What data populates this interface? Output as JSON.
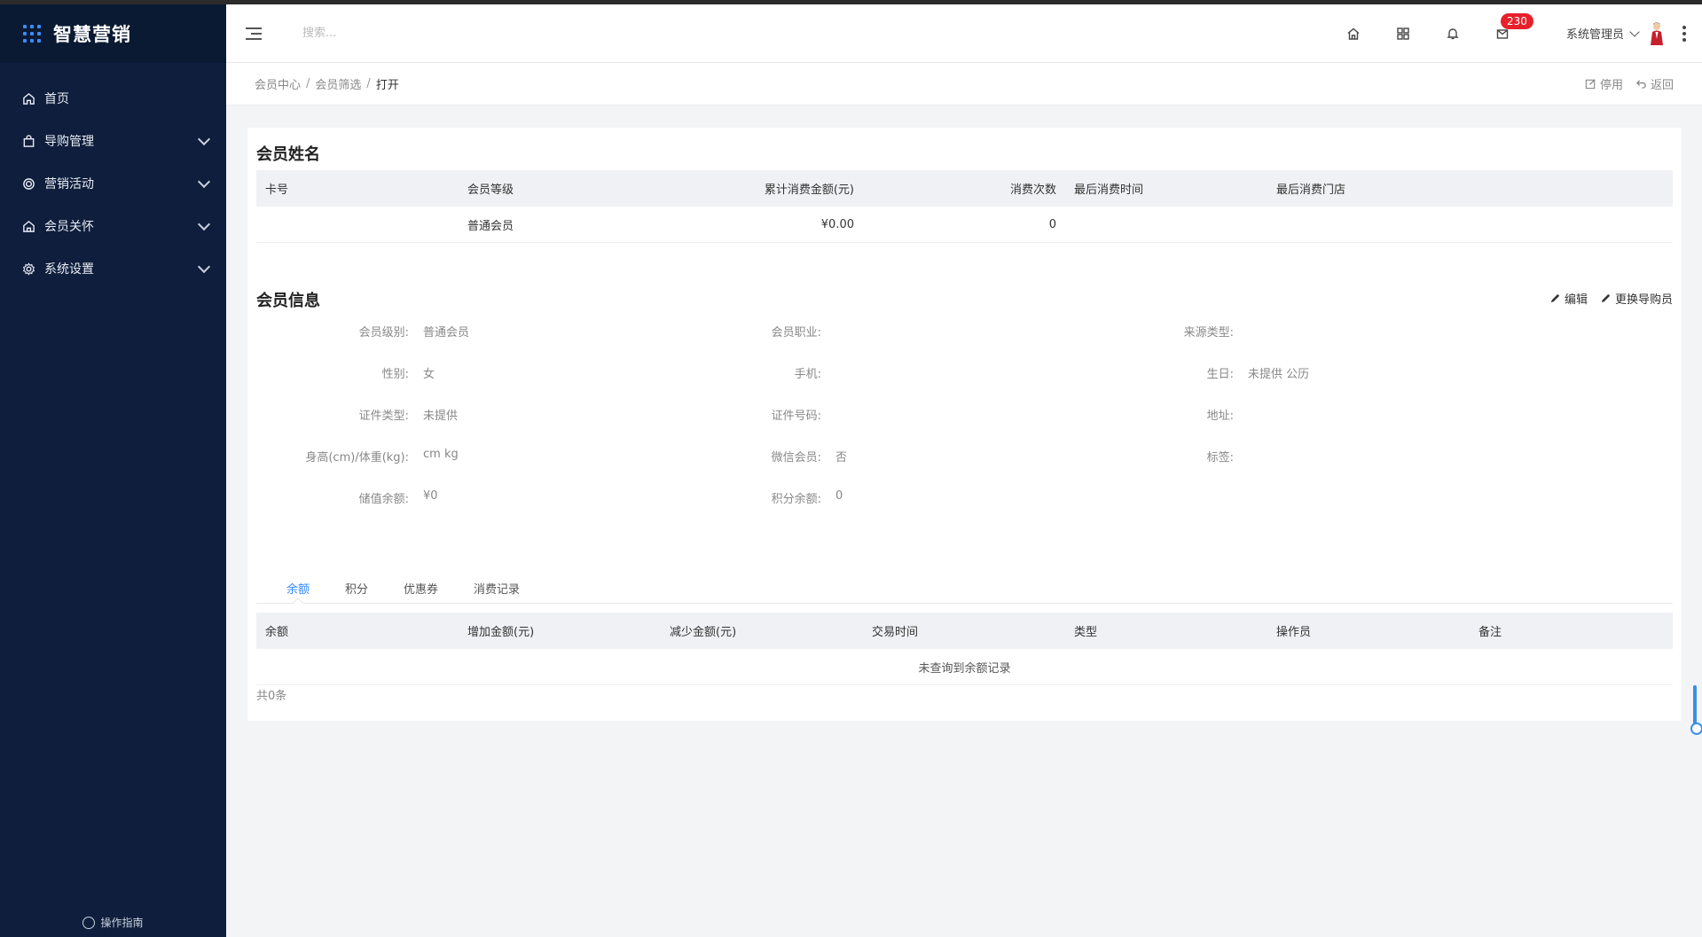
{
  "app": {
    "title": "智慧营销"
  },
  "sidebar": {
    "items": [
      {
        "label": "首页",
        "icon": "home-icon",
        "expandable": false
      },
      {
        "label": "导购管理",
        "icon": "bag-icon",
        "expandable": true
      },
      {
        "label": "营销活动",
        "icon": "target-icon",
        "expandable": true
      },
      {
        "label": "会员关怀",
        "icon": "house-icon",
        "expandable": true
      },
      {
        "label": "系统设置",
        "icon": "gear-icon",
        "expandable": true
      }
    ],
    "guide_label": "操作指南"
  },
  "header": {
    "search_placeholder": "搜索...",
    "message_count": "230",
    "user_name": "系统管理员"
  },
  "breadcrumb": {
    "items": [
      "会员中心",
      "会员筛选",
      "打开"
    ],
    "actions": {
      "disable": "停用",
      "back": "返回"
    }
  },
  "member": {
    "name_title": "会员姓名",
    "summary_headers": [
      "卡号",
      "会员等级",
      "累计消费金额(元)",
      "消费次数",
      "最后消费时间",
      "最后消费门店"
    ],
    "summary_row": [
      "",
      "普通会员",
      "¥0.00",
      "0",
      "",
      ""
    ]
  },
  "info": {
    "title": "会员信息",
    "actions": {
      "edit": "编辑",
      "change_guide": "更换导购员"
    },
    "rows": [
      [
        {
          "label": "会员级别:",
          "value": "普通会员"
        },
        {
          "label": "会员职业:",
          "value": ""
        },
        {
          "label": "来源类型:",
          "value": ""
        }
      ],
      [
        {
          "label": "性别:",
          "value": "女"
        },
        {
          "label": "手机:",
          "value": ""
        },
        {
          "label": "生日:",
          "value": "未提供 公历"
        }
      ],
      [
        {
          "label": "证件类型:",
          "value": "未提供"
        },
        {
          "label": "证件号码:",
          "value": ""
        },
        {
          "label": "地址:",
          "value": ""
        }
      ],
      [
        {
          "label": "身高(cm)/体重(kg):",
          "value": "cm kg"
        },
        {
          "label": "微信会员:",
          "value": "否"
        },
        {
          "label": "标签:",
          "value": ""
        }
      ],
      [
        {
          "label": "储值余额:",
          "value": "¥0"
        },
        {
          "label": "积分余额:",
          "value": "0"
        }
      ]
    ]
  },
  "tabs": [
    "余额",
    "积分",
    "优惠券",
    "消费记录"
  ],
  "balance_table": {
    "headers": [
      "余额",
      "增加金额(元)",
      "减少金额(元)",
      "交易时间",
      "类型",
      "操作员",
      "备注"
    ],
    "empty_text": "未查询到余额记录",
    "total_text": "共0条"
  },
  "colors": {
    "sidebar_bg": "#0e1e3c",
    "accent": "#2f88ff",
    "badge": "#e8202a"
  }
}
